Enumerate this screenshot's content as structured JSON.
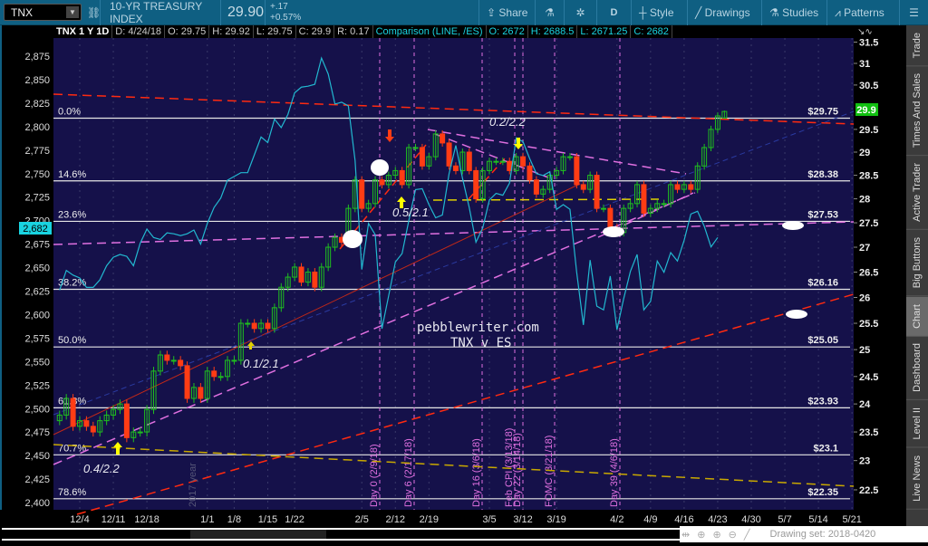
{
  "toolbar": {
    "symbol": "TNX",
    "description": "10-YR TREASURY INDEX",
    "last": "29.90",
    "change": "+.17",
    "change_pct": "+0.57%",
    "buttons": {
      "share": "Share",
      "interval": "D",
      "style": "Style",
      "drawings": "Drawings",
      "studies": "Studies",
      "patterns": "Patterns"
    }
  },
  "info": {
    "title": "TNX 1 Y 1D",
    "date": "D: 4/24/18",
    "open": "O: 29.75",
    "high": "H: 29.92",
    "low": "L: 29.75",
    "close": "C: 29.9",
    "range": "R: 0.17",
    "comparison": "Comparison (LINE, /ES)",
    "cmp_open": "O: 2672",
    "cmp_high": "H: 2688.5",
    "cmp_low": "L: 2671.25",
    "cmp_close": "C: 2682"
  },
  "sidebar": [
    "Trade",
    "Times And Sales",
    "Active Trader",
    "Big Buttons",
    "Chart",
    "Dashboard",
    "Level II",
    "Live News"
  ],
  "sidebar_active": "Chart",
  "bottom": {
    "drawing_set": "Drawing set: 2018-0420"
  },
  "colors": {
    "bg": "#15114a",
    "up": "#1fbf1f",
    "down": "#ff3c14",
    "es_line": "#22b8d0",
    "fib": "#e6e6e6",
    "magenta": "#e070e0",
    "red": "#ff2a10",
    "yellow": "#e0c000"
  },
  "chart_data": {
    "type": "candlestick+line",
    "title": "TNX v ES",
    "watermark": "pebblewriter.com",
    "left_axis": {
      "label": "ES",
      "ticks": [
        "2,400",
        "2,425",
        "2,450",
        "2,475",
        "2,500",
        "2,525",
        "2,550",
        "2,575",
        "2,600",
        "2,625",
        "2,650",
        "2,675",
        "2,700",
        "2,725",
        "2,750",
        "2,775",
        "2,800",
        "2,825",
        "2,850",
        "2,875"
      ],
      "current": "2,682"
    },
    "right_axis": {
      "label": "TNX",
      "scale": "log",
      "ticks": [
        "22.5",
        "23",
        "23.5",
        "24",
        "24.5",
        "25",
        "25.5",
        "26",
        "26.5",
        "27",
        "27.5",
        "28",
        "28.5",
        "29",
        "29.5",
        "30.5",
        "31",
        "31.5"
      ],
      "current": "29.9"
    },
    "x_ticks": [
      [
        "12/4",
        0
      ],
      [
        "12/11",
        5
      ],
      [
        "12/18",
        10
      ],
      [
        "1/1",
        19
      ],
      [
        "1/8",
        23
      ],
      [
        "1/15",
        28
      ],
      [
        "1/22",
        32
      ],
      [
        "2/5",
        42
      ],
      [
        "2/12",
        47
      ],
      [
        "2/19",
        52
      ],
      [
        "3/5",
        61
      ],
      [
        "3/12",
        66
      ],
      [
        "3/19",
        71
      ],
      [
        "4/2",
        80
      ],
      [
        "4/9",
        85
      ],
      [
        "4/16",
        90
      ],
      [
        "4/23",
        95
      ],
      [
        "4/30",
        100
      ],
      [
        "5/7",
        105
      ],
      [
        "5/14",
        110
      ],
      [
        "5/21",
        115
      ]
    ],
    "first_session_index": -3,
    "tnx_close": [
      23.8,
      24.1,
      23.6,
      23.7,
      23.6,
      23.5,
      23.7,
      23.8,
      23.9,
      24.0,
      23.4,
      23.5,
      23.5,
      23.9,
      24.6,
      24.9,
      24.8,
      24.8,
      24.7,
      24.1,
      24.3,
      24.1,
      24.6,
      24.5,
      24.5,
      24.8,
      24.8,
      25.5,
      25.5,
      25.4,
      25.5,
      25.4,
      25.8,
      26.2,
      26.4,
      26.6,
      26.3,
      26.5,
      26.2,
      26.6,
      27.0,
      27.2,
      27.1,
      27.8,
      28.4,
      27.8,
      27.9,
      28.4,
      28.3,
      28.5,
      28.6,
      28.3,
      29.1,
      29.1,
      28.7,
      28.9,
      29.4,
      29.2,
      28.7,
      28.6,
      29.0,
      28.6,
      28.0,
      28.6,
      28.8,
      28.8,
      28.8,
      28.6,
      28.9,
      28.7,
      28.4,
      28.1,
      28.2,
      28.5,
      28.6,
      28.9,
      28.9,
      28.3,
      28.2,
      28.5,
      27.8,
      27.8,
      27.4,
      27.3,
      27.8,
      27.9,
      28.3,
      27.7,
      27.8,
      27.9,
      27.9,
      28.3,
      28.2,
      28.3,
      28.2,
      28.7,
      29.1,
      29.5,
      29.8,
      29.9
    ],
    "tnx_last_ohlc": [
      29.75,
      29.92,
      29.75,
      29.9
    ],
    "es_close": [
      2626,
      2647,
      2642,
      2639,
      2629,
      2629,
      2637,
      2652,
      2661,
      2664,
      2662,
      2652,
      2676,
      2691,
      2682,
      2680,
      2687,
      2686,
      2684,
      2686,
      2690,
      2675,
      2697,
      2714,
      2724,
      2743,
      2747,
      2751,
      2751,
      2770,
      2789,
      2783,
      2808,
      2799,
      2813,
      2836,
      2842,
      2843,
      2845,
      2873,
      2856,
      2824,
      2826,
      2822,
      2764,
      2648,
      2697,
      2685,
      2585,
      2620,
      2656,
      2665,
      2700,
      2733,
      2734,
      2717,
      2703,
      2706,
      2750,
      2780,
      2745,
      2714,
      2677,
      2692,
      2722,
      2729,
      2727,
      2740,
      2788,
      2784,
      2766,
      2750,
      2748,
      2752,
      2712,
      2717,
      2712,
      2645,
      2589,
      2658,
      2609,
      2605,
      2641,
      2584,
      2617,
      2646,
      2664,
      2605,
      2614,
      2657,
      2645,
      2666,
      2657,
      2679,
      2707,
      2710,
      2694,
      2672,
      2682
    ],
    "fib_levels": [
      [
        "0.0%",
        "$29.75",
        29.75
      ],
      [
        "14.6%",
        "$28.38",
        28.38
      ],
      [
        "23.6%",
        "$27.53",
        27.53
      ],
      [
        "38.2%",
        "$26.16",
        26.16
      ],
      [
        "50.0%",
        "$25.05",
        25.05
      ],
      [
        "61.8%",
        "$23.93",
        23.93
      ],
      [
        "70.7%",
        "$23.1",
        23.1
      ],
      [
        "78.6%",
        "$22.35",
        22.35
      ]
    ],
    "events": [
      "Day 0 (2/9/18)",
      "Day 6 (2/17/18)",
      "Day 16 (3/6/18)",
      "Feb CPI (3/13/18)",
      "Day 22 (3/14/18)",
      "FOMC (3/21/18)",
      "Day 39 (4/6/18)"
    ],
    "year_marker": "2017 year",
    "annotations": [
      "0.2/2.2",
      "0.5/2.1",
      "0.1/2.1",
      "0.4/2.2"
    ]
  }
}
